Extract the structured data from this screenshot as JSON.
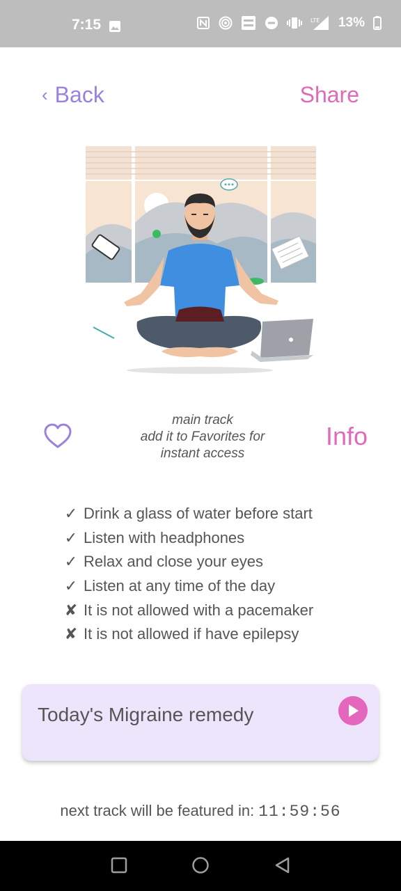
{
  "status_bar": {
    "time": "7:15",
    "battery": "13%",
    "icons": [
      "image-icon",
      "nfc-icon",
      "hotspot-icon",
      "volte-icon",
      "dnd-icon",
      "vibrate-icon",
      "lte-signal-icon",
      "battery-icon"
    ]
  },
  "header": {
    "back_chevron": "‹",
    "back_label": "Back",
    "share_label": "Share"
  },
  "track": {
    "caption_line1": "main track",
    "caption_line2": "add it to Favorites for",
    "caption_line3": "instant access",
    "info_label": "Info",
    "favorite_icon": "heart-outline-icon"
  },
  "tips": [
    {
      "mark": "✓",
      "text": "Drink a glass of water before start"
    },
    {
      "mark": "✓",
      "text": "Listen with headphones"
    },
    {
      "mark": "✓",
      "text": "Relax and close your eyes"
    },
    {
      "mark": "✓",
      "text": "Listen at any time of the day"
    },
    {
      "mark": "✘",
      "text": "It is not allowed with a pacemaker"
    },
    {
      "mark": "✘",
      "text": "It is not allowed if  have epilepsy"
    }
  ],
  "remedy": {
    "title": "Today's Migraine remedy"
  },
  "countdown": {
    "label": "next track will be featured in:",
    "time": "11:59:56"
  },
  "colors": {
    "accent_purple": "#9a82dc",
    "accent_pink": "#e069b8",
    "card_bg": "#ece5fc",
    "text": "#555555"
  }
}
